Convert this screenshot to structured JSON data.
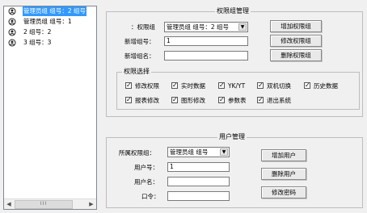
{
  "tree": {
    "items": [
      {
        "label": "管理员组 组号：2 组号",
        "selected": true
      },
      {
        "label": "管理员组 组号：1",
        "selected": false
      },
      {
        "label": "2 组号：2",
        "selected": false
      },
      {
        "label": "3 组号：3",
        "selected": false
      }
    ],
    "scroll_thumb": "III"
  },
  "perm": {
    "title": "权限组管理",
    "group_label": "：权限组",
    "group_value": "管理员组 组号：2 组号",
    "new_id_label": "新增组号：",
    "new_id_value": "1",
    "new_name_label": "新增组名：",
    "new_name_value": "",
    "add_button": "增加权限组",
    "modify_button": "修改权限组",
    "delete_button": "删除权限组",
    "select_title": "权限选择",
    "checks": [
      {
        "label": "修改权限",
        "checked": true
      },
      {
        "label": "实时数据",
        "checked": true
      },
      {
        "label": "YK/YT",
        "checked": true
      },
      {
        "label": "双机切换",
        "checked": true
      },
      {
        "label": "历史数据",
        "checked": true
      },
      {
        "label": "报表修改",
        "checked": true
      },
      {
        "label": "图形修改",
        "checked": true
      },
      {
        "label": "参数表",
        "checked": true
      },
      {
        "label": "退出系统",
        "checked": true
      }
    ]
  },
  "user": {
    "title": "用户管理",
    "group_label": "所属权限组：",
    "group_value": "管理员组 组号",
    "id_label": "用户号：",
    "id_value": "1",
    "name_label": "用户名：",
    "name_value": "",
    "pwd_label": "口令：",
    "pwd_value": "",
    "add_button": "增加用户",
    "delete_button": "删除用户",
    "pwd_button": "修改密码"
  },
  "check_mark": "✓",
  "combo_arrow": "▼",
  "scroll_left": "◀",
  "scroll_right": "▶"
}
